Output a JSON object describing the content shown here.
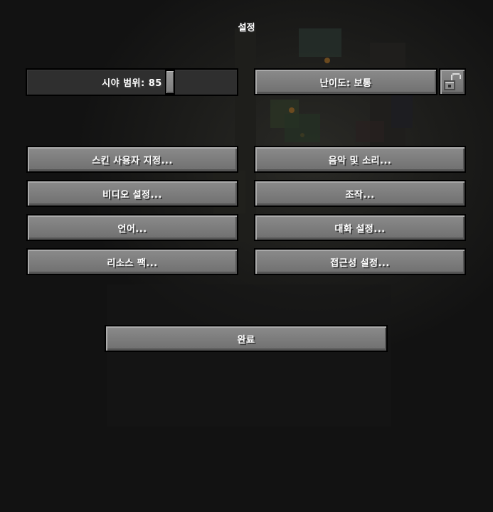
{
  "screen": {
    "title": "설정"
  },
  "view_distance": {
    "label": "시야 범위: 85",
    "value": 85
  },
  "difficulty": {
    "label": "난이도: 보통",
    "lock_icon": "unlocked-padlock-icon"
  },
  "buttons": {
    "skin_customization": "스킨 사용자 지정...",
    "music_sounds": "음악 및 소리...",
    "video_settings": "비디오 설정...",
    "controls": "조작...",
    "language": "언어...",
    "chat_settings": "대화 설정...",
    "resource_packs": "리소스 팩...",
    "accessibility": "접근성 설정...",
    "done": "완료"
  }
}
